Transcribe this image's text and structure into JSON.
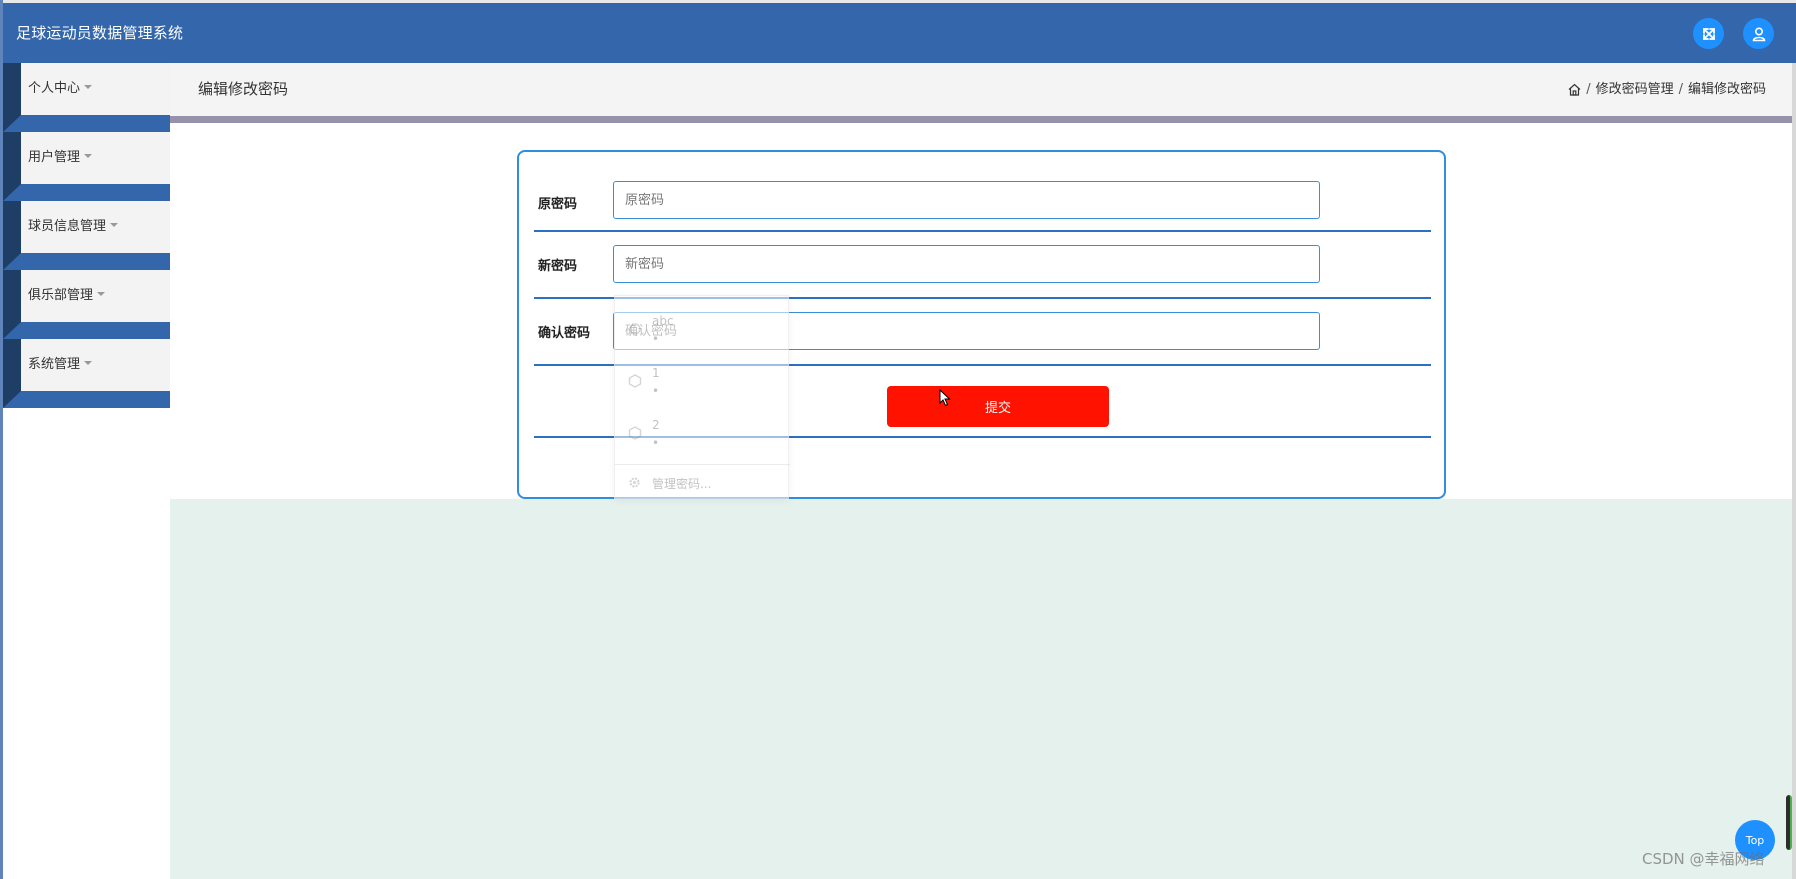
{
  "app": {
    "title": "足球运动员数据管理系统"
  },
  "header_icons": {
    "fullscreen": "fullscreen-icon",
    "user": "user-icon"
  },
  "sidebar": {
    "items": [
      {
        "label": "个人中心"
      },
      {
        "label": "用户管理"
      },
      {
        "label": "球员信息管理"
      },
      {
        "label": "俱乐部管理"
      },
      {
        "label": "系统管理"
      }
    ]
  },
  "breadcrumb": {
    "page_title": "编辑修改密码",
    "home_icon": "home-icon",
    "items": [
      "修改密码管理",
      "编辑修改密码"
    ],
    "separator": "/"
  },
  "form": {
    "fields": [
      {
        "label": "原密码",
        "placeholder": "原密码",
        "value": ""
      },
      {
        "label": "新密码",
        "placeholder": "新密码",
        "value": ""
      },
      {
        "label": "确认密码",
        "placeholder": "确认密码",
        "value": ""
      }
    ],
    "submit_label": "提交"
  },
  "autofill_popup": {
    "entries": [
      {
        "user": "abc",
        "password_mask": "•"
      },
      {
        "user": "1",
        "password_mask": "•"
      },
      {
        "user": "2",
        "password_mask": "•"
      }
    ],
    "manage_label": "管理密码..."
  },
  "floating": {
    "top_label": "Top"
  },
  "watermark": "CSDN @幸福网络",
  "colors": {
    "header": "#3366aa",
    "accent_blue": "#1e90ff",
    "submit": "#ff1200",
    "lower_bg": "#e5f1ec",
    "border_blue": "#2f8ee0"
  }
}
